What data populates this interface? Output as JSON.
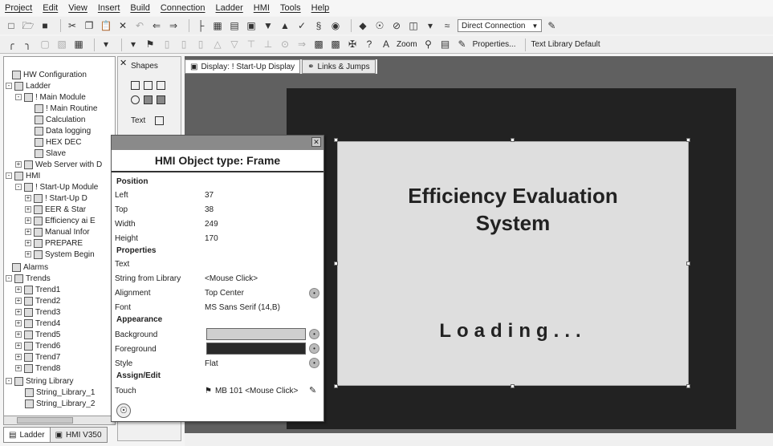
{
  "menu": [
    "Project",
    "Edit",
    "View",
    "Insert",
    "Build",
    "Connection",
    "Ladder",
    "HMI",
    "Tools",
    "Help"
  ],
  "toolbar1": {
    "connection_value": "Direct Connection"
  },
  "toolbar2": {
    "zoom_label": "Zoom",
    "properties_label": "Properties...",
    "text_library_value": "Text Library Default"
  },
  "tree": {
    "hw_config": "HW Configuration",
    "ladder": "Ladder",
    "main_module": "! Main Module",
    "main_routine": "! Main Routine",
    "calculation": "Calculation",
    "data_logging": "Data logging",
    "hex_dec": "HEX DEC",
    "slave": "Slave",
    "web_server": "Web Server with D",
    "hmi": "HMI",
    "startup_module": "! Start-Up Module",
    "startup_display": "! Start-Up D",
    "eer_star": "EER & Star",
    "efficiency": "Efficiency ai E",
    "manual_info": "Manual Infor",
    "prepare": "PREPARE",
    "system_begin": "System Begin",
    "alarms": "Alarms",
    "trends": "Trends",
    "trend_items": [
      "Trend1",
      "Trend2",
      "Trend3",
      "Trend4",
      "Trend5",
      "Trend6",
      "Trend7",
      "Trend8"
    ],
    "string_library": "String Library",
    "string_library_1": "String_Library_1",
    "string_library_2": "String_Library_2"
  },
  "bottom_tabs": [
    "Ladder",
    "HMI V350"
  ],
  "shapes": {
    "title": "Shapes",
    "text_label": "Text"
  },
  "doc_tabs": [
    "Display: ! Start-Up Display",
    "Links & Jumps"
  ],
  "canvas": {
    "title_line1": "Efficiency Evaluation",
    "title_line2": "System",
    "loading": "Loading..."
  },
  "props": {
    "header": "HMI Object type: Frame",
    "sections": {
      "position": "Position",
      "properties": "Properties",
      "appearance": "Appearance",
      "assign": "Assign/Edit"
    },
    "rows": {
      "left": {
        "label": "Left",
        "value": "37"
      },
      "top": {
        "label": "Top",
        "value": "38"
      },
      "width": {
        "label": "Width",
        "value": "249"
      },
      "height": {
        "label": "Height",
        "value": "170"
      },
      "text": {
        "label": "Text",
        "value": ""
      },
      "string_from_library": {
        "label": "String from Library",
        "value": "<Mouse Click>"
      },
      "alignment": {
        "label": "Alignment",
        "value": "Top Center"
      },
      "font": {
        "label": "Font",
        "value": "MS Sans Serif (14,B)"
      },
      "background": {
        "label": "Background"
      },
      "foreground": {
        "label": "Foreground"
      },
      "style": {
        "label": "Style",
        "value": "Flat"
      },
      "touch": {
        "label": "Touch",
        "value": "MB 101 <Mouse Click>"
      }
    },
    "colors": {
      "background": "#cfcfcf",
      "foreground": "#2a2a2a"
    }
  },
  "colors": {
    "editor_bg": "#606060",
    "screen_bg": "#222222",
    "frame_bg": "#dedede"
  }
}
